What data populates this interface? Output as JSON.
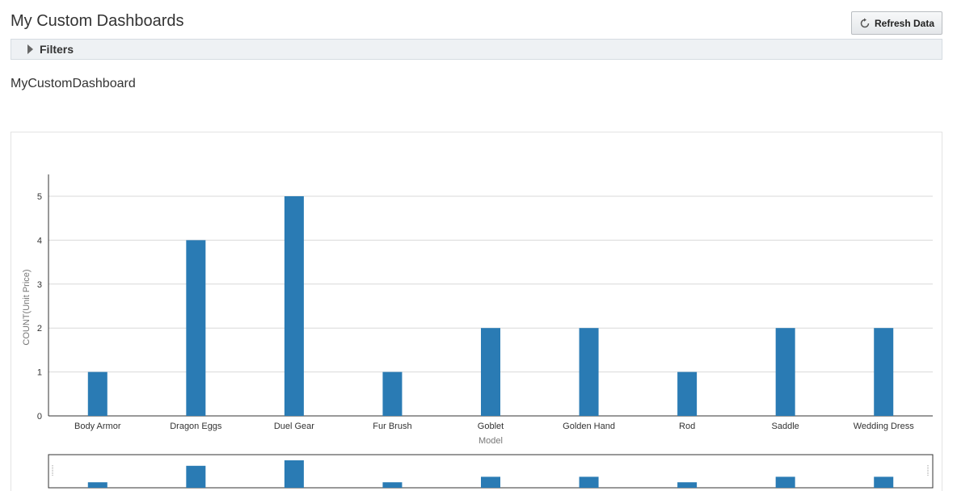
{
  "header": {
    "title": "My Custom Dashboards",
    "refresh_label": "Refresh Data"
  },
  "filters": {
    "label": "Filters"
  },
  "dashboard": {
    "name": "MyCustomDashboard"
  },
  "colors": {
    "bar": "#2a7bb4",
    "grid": "#d9d9d9",
    "axis": "#333333"
  },
  "chart_data": {
    "type": "bar",
    "categories": [
      "Body Armor",
      "Dragon Eggs",
      "Duel Gear",
      "Fur Brush",
      "Goblet",
      "Golden Hand",
      "Rod",
      "Saddle",
      "Wedding Dress"
    ],
    "series": [
      {
        "values": [
          1,
          4,
          5,
          1,
          2,
          2,
          1,
          2,
          2
        ]
      }
    ],
    "xlabel": "Model",
    "ylabel": "COUNT(Unit Price)",
    "ylim": [
      0,
      5
    ],
    "yticks": [
      0,
      1,
      2,
      3,
      4,
      5
    ],
    "grid": true,
    "overview_navigator": true
  }
}
